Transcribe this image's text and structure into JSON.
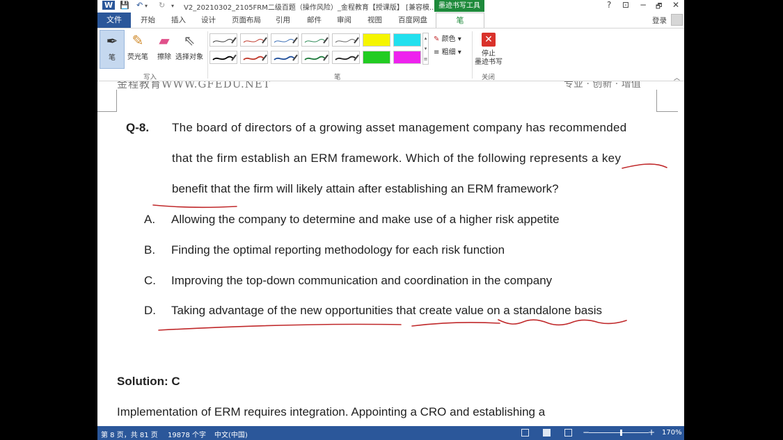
{
  "titlebar": {
    "word_icon": "W",
    "save_icon": "💾",
    "undo_icon": "↶",
    "redo_icon": "↻",
    "title": "V2_20210302_2105FRM二级百题（操作风险）_金程教育【授课版】 [兼容模...",
    "ink_tools_label": "墨迹书写工具",
    "help": "?",
    "restore": "⊡",
    "minimize": "−",
    "maximize": "🗗",
    "close": "✕"
  },
  "tabs": {
    "file": "文件",
    "items": [
      "开始",
      "插入",
      "设计",
      "页面布局",
      "引用",
      "邮件",
      "审阅",
      "视图",
      "百度网盘"
    ],
    "active": "笔",
    "login": "登录"
  },
  "ribbon": {
    "write_tools": [
      {
        "label": "笔",
        "icon": "pen-icon"
      },
      {
        "label": "荧光笔",
        "icon": "highlighter-icon"
      },
      {
        "label": "擦除",
        "icon": "eraser-icon"
      },
      {
        "label": "选择对象",
        "icon": "select-cursor-icon"
      }
    ],
    "group_write": "写入",
    "group_pens": "笔",
    "group_close": "关闭",
    "color_label": "颜色",
    "thickness_label": "粗细",
    "stop_ink_line1": "停止",
    "stop_ink_line2": "墨迹书写",
    "pen_colors_row1": [
      "#3a3a3a",
      "#c0392b",
      "#3b6fb6",
      "#2e8b57",
      "#666666"
    ],
    "pen_colors_row2": [
      "#000000",
      "#c0392b",
      "#1f4e9a",
      "#1e7a3c",
      "#222222"
    ],
    "highlight_colors_row1": [
      "#f5f500",
      "#22e0ee"
    ],
    "highlight_colors_row2": [
      "#22cc22",
      "#ee22ee"
    ]
  },
  "document": {
    "header_left": "金程教育WWW.GFEDU.NET",
    "header_right": "专业 · 创新 · 增值",
    "question_number": "Q-8.",
    "question_lines": [
      "The board of directors of a growing asset management company has recommended",
      "that the firm establish an ERM framework. Which of the following represents a key",
      "benefit that the firm will likely attain after establishing an ERM framework?"
    ],
    "options": [
      {
        "letter": "A.",
        "text": "Allowing the company to determine and make use of a higher risk appetite"
      },
      {
        "letter": "B.",
        "text": "Finding the optimal reporting methodology for each risk function"
      },
      {
        "letter": "C.",
        "text": "Improving the top-down communication and coordination in the company"
      },
      {
        "letter": "D.",
        "text": "Taking advantage of the new opportunities that create value on a standalone basis"
      }
    ],
    "solution_label": "Solution: C",
    "solution_text": "Implementation of ERM requires integration. Appointing a CRO and establishing a",
    "ink_color": "#c0292b"
  },
  "status": {
    "page": "第 8 页，共 81 页",
    "words": "19878 个字",
    "language": "中文(中国)",
    "zoom_minus": "−",
    "zoom_plus": "+",
    "zoom": "170%",
    "zoom_level_percent": 53
  }
}
